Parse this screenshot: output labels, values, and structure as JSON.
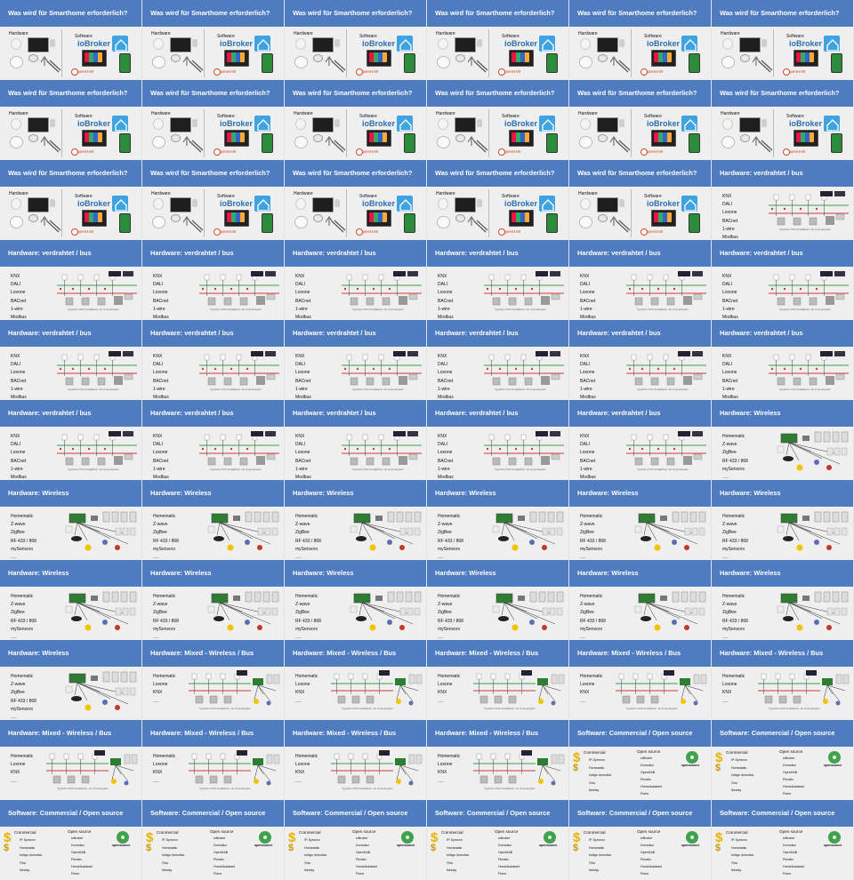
{
  "theme": {
    "header_color": "#4f7cc1",
    "body_color": "#efefef",
    "header_text_color": "#ffffff",
    "bus_red": "#d23b3b",
    "bus_green": "#3aa14a"
  },
  "slide_types": {
    "requirements": {
      "title": "Was wird für Smarthome erforderlich?",
      "hardware_label": "Hardware",
      "software_label": "Software",
      "brand_text": "ioBroker",
      "brand_small": "openHAB"
    },
    "bus": {
      "title": "Hardware: verdrahtet / bus",
      "items": [
        "KNX",
        "DALI",
        "Loxone",
        "BACnet",
        "1-wire",
        "Modbus"
      ],
      "caption": "Typische KNX-Installation mit Linienkoppler"
    },
    "wireless": {
      "title": "Hardware: Wireless",
      "items": [
        "Homematic",
        "Z-wave",
        "ZigBee",
        "RF 433 / 868",
        "mySensors",
        "....."
      ]
    },
    "mixed": {
      "title": "Hardware: Mixed - Wireless / Bus",
      "items": [
        "Homematic",
        "Loxone",
        "KNX",
        "....."
      ],
      "caption": "Typische KNX-Installation mit Linienkoppler"
    },
    "software": {
      "title": "Software: Commercial / Open source",
      "commercial_label": "Commercial",
      "commercial_items": [
        "IP-Symcon",
        "Homeaatic",
        "Indigo domotics",
        "Gira",
        "Ikestsy"
      ],
      "open_label": "Open source",
      "open_items": [
        "ioBroker",
        "Domoticz",
        "OpenHAB",
        "Pimatic",
        "HomeAssistant",
        "Fhem"
      ],
      "logo_text": "opensource"
    }
  },
  "slides": [
    "requirements",
    "requirements",
    "requirements",
    "requirements",
    "requirements",
    "requirements",
    "requirements",
    "requirements",
    "requirements",
    "requirements",
    "requirements",
    "requirements",
    "requirements",
    "requirements",
    "requirements",
    "requirements",
    "requirements",
    "bus",
    "bus",
    "bus",
    "bus",
    "bus",
    "bus",
    "bus",
    "bus",
    "bus",
    "bus",
    "bus",
    "bus",
    "bus",
    "bus",
    "bus",
    "bus",
    "bus",
    "bus",
    "wireless",
    "wireless",
    "wireless",
    "wireless",
    "wireless",
    "wireless",
    "wireless",
    "wireless",
    "wireless",
    "wireless",
    "wireless",
    "wireless",
    "wireless",
    "wireless",
    "mixed",
    "mixed",
    "mixed",
    "mixed",
    "mixed",
    "mixed",
    "mixed",
    "mixed",
    "mixed",
    "software",
    "software",
    "software",
    "software",
    "software",
    "software",
    "software",
    "software"
  ]
}
